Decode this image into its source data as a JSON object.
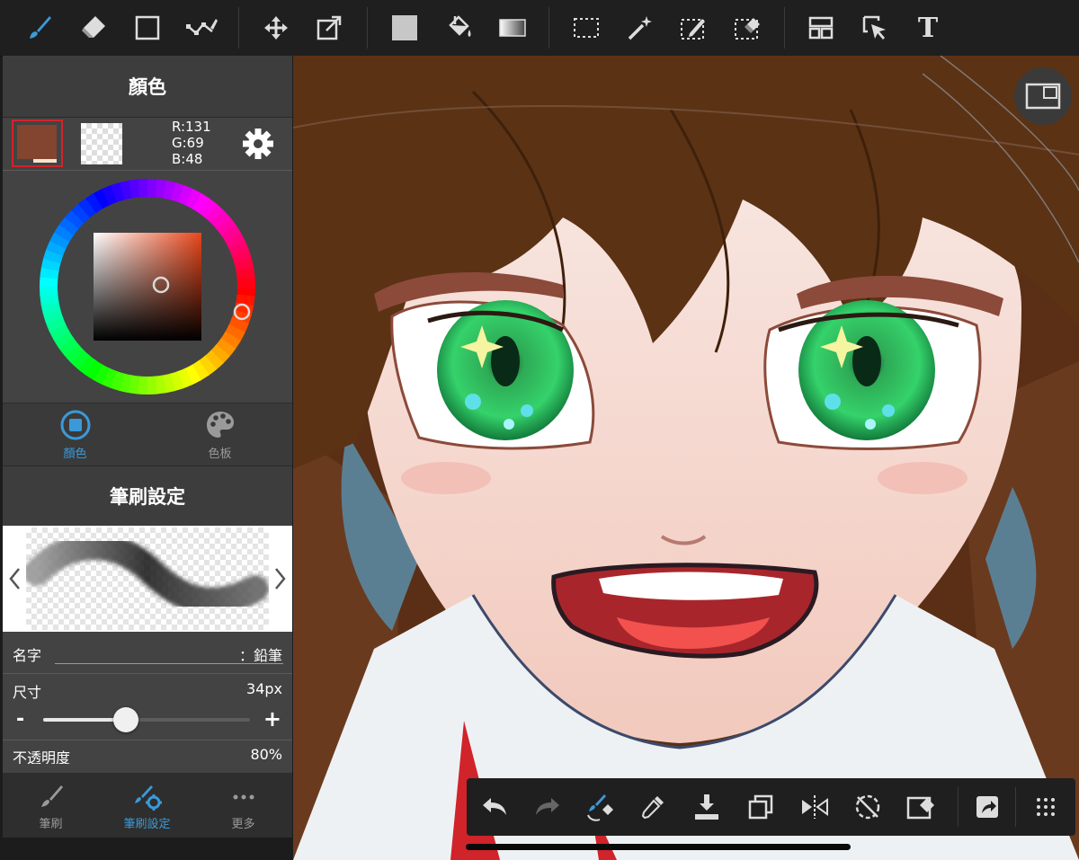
{
  "toolbar": {
    "tools": [
      {
        "name": "brush-tool",
        "icon": "brush-icon",
        "active": true
      },
      {
        "name": "eraser-tool",
        "icon": "eraser-icon"
      },
      {
        "name": "shape-tool",
        "icon": "square-icon"
      },
      {
        "name": "line-tool",
        "icon": "polyline-icon"
      },
      {
        "name": "move-tool",
        "icon": "move-icon"
      },
      {
        "name": "transform-tool",
        "icon": "transform-icon"
      },
      {
        "name": "fill-color-tool",
        "icon": "fill-swatch-icon"
      },
      {
        "name": "bucket-tool",
        "icon": "paint-bucket-icon"
      },
      {
        "name": "gradient-tool",
        "icon": "gradient-icon"
      },
      {
        "name": "rect-select-tool",
        "icon": "rect-select-icon"
      },
      {
        "name": "magic-wand-tool",
        "icon": "magic-wand-icon"
      },
      {
        "name": "select-pen-tool",
        "icon": "select-pen-icon"
      },
      {
        "name": "select-eraser-tool",
        "icon": "select-eraser-icon"
      },
      {
        "name": "panel-layout-tool",
        "icon": "panel-layout-icon"
      },
      {
        "name": "operation-tool",
        "icon": "cursor-icon"
      },
      {
        "name": "text-tool",
        "icon": "text-icon",
        "label": "T"
      }
    ]
  },
  "color_panel": {
    "title": "顏色",
    "current_color": "#83452f",
    "secondary_color": "#f8e3cc",
    "rgb": {
      "r": "R:131",
      "g": "G:69",
      "b": "B:48"
    },
    "tabs": [
      {
        "label": "顏色",
        "active": true,
        "icon": "color-circle-icon"
      },
      {
        "label": "色板",
        "active": false,
        "icon": "palette-icon"
      }
    ]
  },
  "brush_panel": {
    "title": "筆刷設定",
    "name_label": "名字",
    "name_value": "：鉛筆",
    "size_label": "尺寸",
    "size_value": "34px",
    "size_level": 0.4,
    "minus": "-",
    "plus": "+",
    "opacity_label": "不透明度",
    "opacity_value": "80%"
  },
  "bottom_tabs": [
    {
      "label": "筆刷",
      "active": false,
      "icon": "brush-icon"
    },
    {
      "label": "筆刷設定",
      "active": true,
      "icon": "brush-settings-icon"
    },
    {
      "label": "更多",
      "active": false,
      "icon": "more-dots-icon"
    }
  ],
  "bottom_toolbar": {
    "items": [
      "undo-icon",
      "redo-icon",
      "brush-swap-icon",
      "eyedropper-icon",
      "download-icon",
      "layers-icon",
      "flip-icon",
      "rotate-reset-icon",
      "clear-icon",
      "share-icon",
      "grid-menu-icon"
    ]
  },
  "colors": {
    "accent": "#3a9ad9",
    "toolbar_bg": "#1f1f1f",
    "panel_bg": "#434343"
  }
}
